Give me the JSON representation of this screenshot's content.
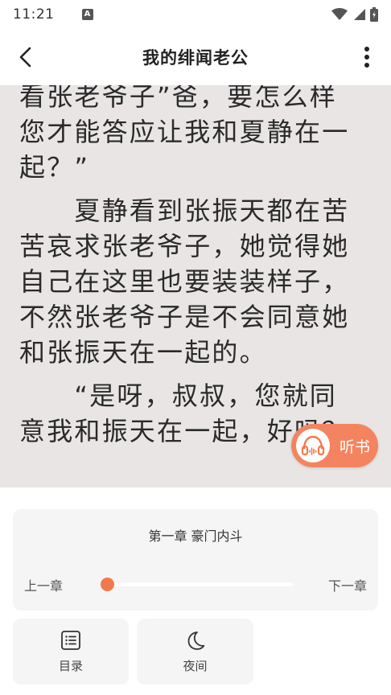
{
  "status_bar": {
    "time": "11:21",
    "notification_letter": "A",
    "icons": [
      "wifi-icon",
      "signal-icon",
      "battery-icon"
    ]
  },
  "header": {
    "title": "我的绯闻老公",
    "back_icon": "back-arrow-icon",
    "more_icon": "more-vertical-icon"
  },
  "reader": {
    "lines": [
      "看张老爷子”爸，要怎么样",
      "您才能答应让我和夏静在一",
      "起？”",
      "　　夏静看到张振天都在苦",
      "苦哀求张老爷子，她觉得她",
      "自己在这里也要装装样子，",
      "不然张老爷子是不会同意她",
      "和张振天在一起的。",
      "　　“是呀，叔叔，您就同",
      "意我和振天在一起，好吗？"
    ],
    "paragraph_gap_before": [
      3,
      8
    ]
  },
  "listen_button": {
    "label": "听书",
    "icon": "headphones-icon"
  },
  "chapter_panel": {
    "chapter_title": "第一章 豪门内斗",
    "prev_label": "上一章",
    "next_label": "下一章",
    "progress": 0.03
  },
  "tools": {
    "toc_label": "目录",
    "toc_icon": "list-icon",
    "night_label": "夜间",
    "night_icon": "moon-icon"
  },
  "colors": {
    "accent": "#f07a4c",
    "listen_bg": "#f4845f",
    "reader_bg": "#e8e5e4",
    "panel_card": "#f5f5f5"
  }
}
